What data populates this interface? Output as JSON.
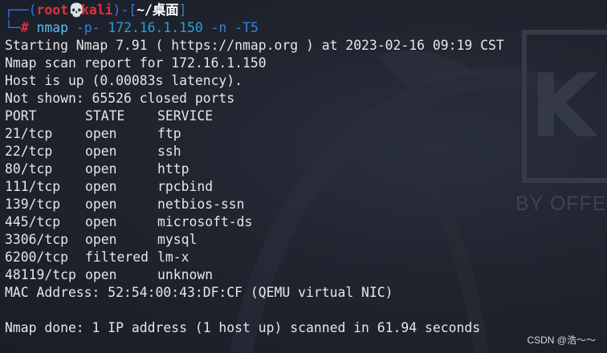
{
  "prompt": {
    "corner_top": "┌──",
    "open_paren": "(",
    "user": "root",
    "skull": "💀",
    "host": "kali",
    "close_paren": ")",
    "dash_bracket": "-[",
    "path": "~/桌面",
    "close_bracket": "]",
    "corner_bottom": "└─",
    "hash": "#",
    "command": "nmap",
    "arg_flag": "-p-",
    "arg_target": "172.16.1.150",
    "arg_n": "-n",
    "arg_t": "-T5"
  },
  "output_lines": [
    "Starting Nmap 7.91 ( https://nmap.org ) at 2023-02-16 09:19 CST",
    "Nmap scan report for 172.16.1.150",
    "Host is up (0.00083s latency).",
    "Not shown: 65526 closed ports"
  ],
  "table": {
    "headers": [
      "PORT",
      "STATE",
      "SERVICE"
    ],
    "rows": [
      [
        "21/tcp",
        "open",
        "ftp"
      ],
      [
        "22/tcp",
        "open",
        "ssh"
      ],
      [
        "80/tcp",
        "open",
        "http"
      ],
      [
        "111/tcp",
        "open",
        "rpcbind"
      ],
      [
        "139/tcp",
        "open",
        "netbios-ssn"
      ],
      [
        "445/tcp",
        "open",
        "microsoft-ds"
      ],
      [
        "3306/tcp",
        "open",
        "mysql"
      ],
      [
        "6200/tcp",
        "filtered",
        "lm-x"
      ],
      [
        "48119/tcp",
        "open",
        "unknown"
      ]
    ]
  },
  "mac_line": "MAC Address: 52:54:00:43:DF:CF (QEMU virtual NIC)",
  "blank_line": "",
  "done_line": "Nmap done: 1 IP address (1 host up) scanned in 61.94 seconds",
  "wallpaper_brand": "BY OFFE",
  "watermark": "CSDN @浩～～",
  "colors": {
    "background": "#1b1f2a",
    "prompt_frame": "#3b74e0",
    "user_host": "#e0303a",
    "command": "#55c0f0",
    "text": "#e6e6e6"
  }
}
